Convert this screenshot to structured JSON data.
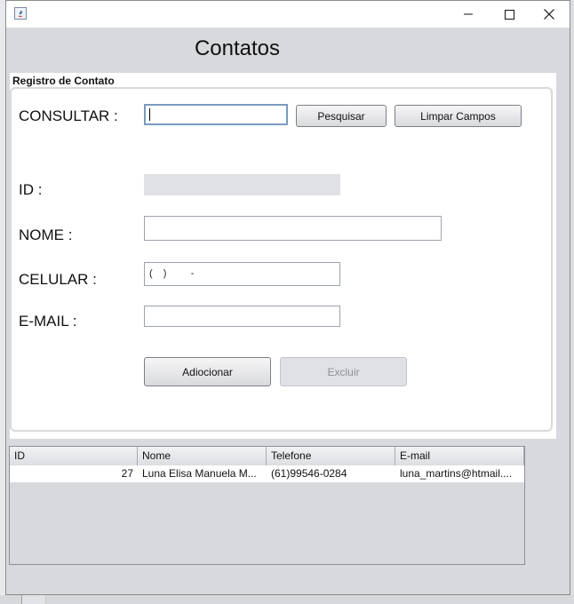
{
  "window": {
    "title": "",
    "heading": "Contatos",
    "icon": "java-icon",
    "controls": [
      "minimize-icon",
      "maximize-icon",
      "close-icon"
    ]
  },
  "registro": {
    "title": "Registro de Contato",
    "consultar_label": "CONSULTAR :",
    "consultar_value": "",
    "pesquisar_label": "Pesquisar",
    "limpar_label": "Limpar Campos",
    "id_label": "ID :",
    "id_value": "",
    "nome_label": "NOME :",
    "nome_value": "",
    "celular_label": "CELULAR :",
    "celular_value": "(  )     -",
    "email_label": "E-MAIL :",
    "email_value": "",
    "adicionar_label": "Adiocionar",
    "excluir_label": "Excluir"
  },
  "table": {
    "columns": [
      "ID",
      "Nome",
      "Telefone",
      "E-mail"
    ],
    "rows": [
      {
        "id": "27",
        "nome": "Luna Elisa Manuela M...",
        "telefone": "(61)99546-0284",
        "email": "luna_martins@htmail...."
      }
    ]
  },
  "colors": {
    "window_bg": "#d8d9dd",
    "panel_bg": "#ffffff",
    "focus_border": "#7a9bbf"
  }
}
